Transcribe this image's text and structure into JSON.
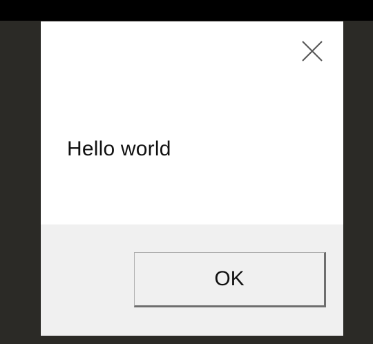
{
  "dialog": {
    "close_icon": "close-icon",
    "message": "Hello world",
    "ok_label": "OK"
  },
  "colors": {
    "background": "#2b2a26",
    "dialog_body": "#ffffff",
    "dialog_footer": "#f0f0f0",
    "text": "#111111"
  }
}
